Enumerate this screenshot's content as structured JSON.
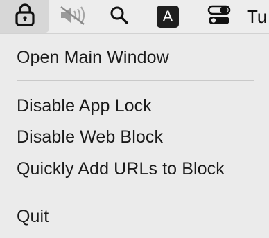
{
  "menubar": {
    "icons": [
      "lock-icon",
      "speaker-muted-icon",
      "search-icon",
      "input-source-icon",
      "control-center-icon"
    ],
    "input_source_letter": "A",
    "clock_partial": "Tu"
  },
  "menu": {
    "open_main_window": "Open Main Window",
    "disable_app_lock": "Disable App Lock",
    "disable_web_block": "Disable Web Block",
    "quick_add_urls": "Quickly Add URLs to Block",
    "quit": "Quit"
  },
  "colors": {
    "menu_background": "#ebebeb",
    "highlight_background": "#d7d7d7",
    "separator": "#c9c9c9",
    "text": "#1a1a1a"
  }
}
